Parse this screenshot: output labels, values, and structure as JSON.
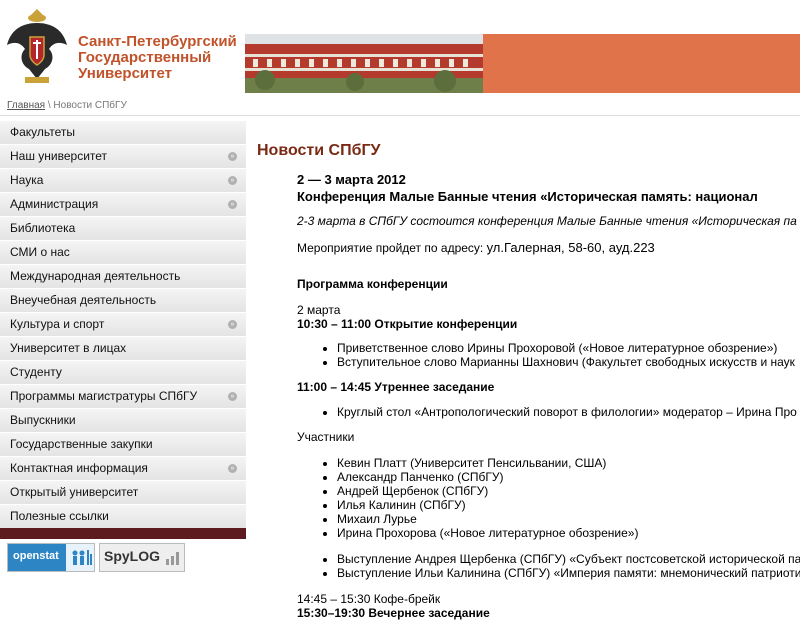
{
  "header": {
    "university_name_line1": "Санкт-Петербургский",
    "university_name_line2": "Государственный",
    "university_name_line3": "Университет"
  },
  "breadcrumb": {
    "home": "Главная",
    "separator": " \\ ",
    "current": "Новости СПбГУ"
  },
  "sidebar": {
    "items": [
      {
        "label": "Факультеты",
        "arrow": false
      },
      {
        "label": "Наш университет",
        "arrow": true
      },
      {
        "label": "Наука",
        "arrow": true
      },
      {
        "label": "Администрация",
        "arrow": true
      },
      {
        "label": "Библиотека",
        "arrow": false
      },
      {
        "label": "СМИ о нас",
        "arrow": false
      },
      {
        "label": "Международная деятельность",
        "arrow": false
      },
      {
        "label": "Внеучебная деятельность",
        "arrow": false
      },
      {
        "label": "Культура и спорт",
        "arrow": true
      },
      {
        "label": "Университет в лицах",
        "arrow": false
      },
      {
        "label": "Студенту",
        "arrow": false
      },
      {
        "label": "Программы магистратуры СПбГУ",
        "arrow": true
      },
      {
        "label": "Выпускники",
        "arrow": false
      },
      {
        "label": "Государственные закупки",
        "arrow": false
      },
      {
        "label": "Контактная информация",
        "arrow": true
      },
      {
        "label": "Открытый университет",
        "arrow": false
      },
      {
        "label": "Полезные ссылки",
        "arrow": false
      }
    ]
  },
  "counters": {
    "openstat": "openstat",
    "spylog": "SpyLOG"
  },
  "main": {
    "title": "Новости СПбГУ",
    "dates": "2 — 3 марта 2012",
    "headline": "Конференция Малые Банные чтения «Историческая память: национал",
    "lead": "2-3 марта в СПбГУ состоится конференция Малые Банные чтения «Историческая па",
    "address_prefix": "Мероприятие пройдет по адресу: ",
    "address": "ул.Галерная, 58-60, ауд.223",
    "program_title": "Программа конференции",
    "day": "2 марта",
    "session1": "10:30 – 11:00 Открытие конференции",
    "session1_items": [
      "Приветственное слово Ирины Прохоровой («Новое литературное обозрение»)",
      "Вступительное слово Марианны Шахнович (Факультет свободных искусств и наук"
    ],
    "session2": "11:00 – 14:45 Утреннее заседание",
    "session2_items": [
      "Круглый стол «Антропологический поворот в филологии» модератор – Ирина Про"
    ],
    "participants_label": "Участники",
    "participants": [
      "Кевин Платт (Университет Пенсильвании, США)",
      "Александр Панченко (СПбГУ)",
      "Андрей Щербенок (СПбГУ)",
      "Илья Калинин (СПбГУ)",
      "Михаил Лурье",
      "Ирина Прохорова («Новое литературное обозрение»)"
    ],
    "talks": [
      "Выступление Андрея Щербенка (СПбГУ) «Субъект постсоветской исторической па",
      "Выступление Ильи Калинина (СПбГУ) «Империя памяти: мнемонический патриоти"
    ],
    "break": "14:45 – 15:30 Кофе-брейк",
    "session3": "15:30–19:30 Вечернее заседание"
  }
}
